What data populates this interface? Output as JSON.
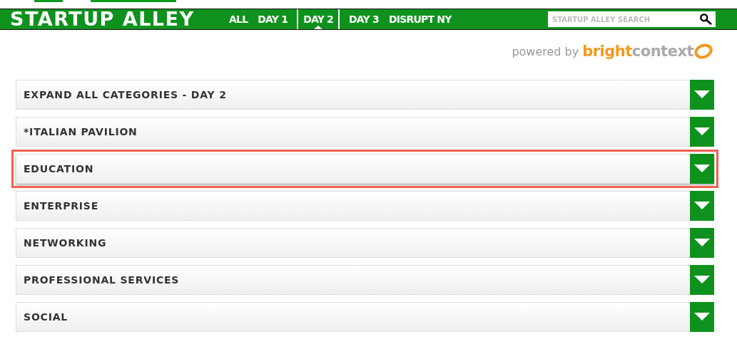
{
  "header": {
    "title": "STARTUP ALLEY",
    "nav": [
      {
        "label": "ALL",
        "selected": false
      },
      {
        "label": "DAY 1",
        "selected": false
      },
      {
        "label": "DAY 2",
        "selected": true
      },
      {
        "label": "DAY 3",
        "selected": false
      },
      {
        "label": "DISRUPT NY",
        "selected": false
      }
    ],
    "search": {
      "placeholder": "STARTUP ALLEY SEARCH"
    }
  },
  "powered_by": {
    "prefix": "powered by",
    "brand_bold": "bright",
    "brand_rest": "context"
  },
  "categories": [
    {
      "label": "EXPAND ALL CATEGORIES - DAY 2",
      "highlighted": false
    },
    {
      "label": "*ITALIAN PAVILION",
      "highlighted": false
    },
    {
      "label": "EDUCATION",
      "highlighted": true
    },
    {
      "label": "ENTERPRISE",
      "highlighted": false
    },
    {
      "label": "NETWORKING",
      "highlighted": false
    },
    {
      "label": "PROFESSIONAL SERVICES",
      "highlighted": false
    },
    {
      "label": "SOCIAL",
      "highlighted": false
    }
  ]
}
